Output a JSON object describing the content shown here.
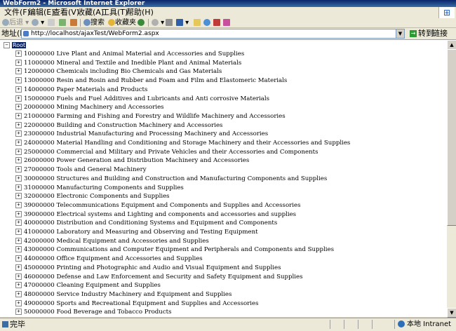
{
  "window": {
    "title": "WebForm2 - Microsoft Internet Explorer"
  },
  "menu": [
    "文件(F)",
    "编辑(E)",
    "查看(V)",
    "收藏(A)",
    "工具(T)",
    "帮助(H)"
  ],
  "toolbar": {
    "back": "后退",
    "search": "搜索",
    "favorites": "收藏夹"
  },
  "address": {
    "label": "地址(D)",
    "url": "http://localhost/ajaxTest/WebForm2.aspx",
    "go": "转到",
    "links": "链接"
  },
  "tree": {
    "root": "Root",
    "nodes": [
      "10000000 Live Plant and Animal Material and Accessories and Supplies",
      "11000000 Mineral and Textile and Inedible Plant and Animal Materials",
      "12000000 Chemicals including Bio Chemicals and Gas Materials",
      "13000000 Resin and Rosin and Rubber and Foam and Film and Elastomeric Materials",
      "14000000 Paper Materials and Products",
      "15000000 Fuels and Fuel Additives and Lubricants and Anti corrosive Materials",
      "20000000 Mining Machinery and Accessories",
      "21000000 Farming and Fishing and Forestry and Wildlife Machinery and Accessories",
      "22000000 Building and Construction Machinery and Accessories",
      "23000000 Industrial Manufacturing and Processing Machinery and Accessories",
      "24000000 Material Handling and Conditioning and Storage Machinery and their Accessories and Supplies",
      "25000000 Commercial and Military and Private Vehicles and their Accessories and Components",
      "26000000 Power Generation and Distribution Machinery and Accessories",
      "27000000 Tools and General Machinery",
      "30000000 Structures and Building and Construction and Manufacturing Components and Supplies",
      "31000000 Manufacturing Components and Supplies",
      "32000000 Electronic Components and Supplies",
      "39000000 Telecommunications Equipment and Components and Supplies and Accessories",
      "39000000 Electrical systems and Lighting and components and accessories and supplies",
      "40000000 Distribution and Conditioning Systems and Equipment and Components",
      "41000000 Laboratory and Measuring and Observing and Testing Equipment",
      "42000000 Medical Equipment and Accessories and Supplies",
      "43000000 Communications and Computer Equipment and Peripherals and Components and Supplies",
      "44000000 Office Equipment and Accessories and Supplies",
      "45000000 Printing and Photographic and Audio and Visual Equipment and Supplies",
      "46000000 Defense and Law Enforcement and Security and Safety Equipment and Supplies",
      "47000000 Cleaning Equipment and Supplies",
      "48000000 Service Industry Machinery and Equipment and Supplies",
      "49000000 Sports and Recreational Equipment and Supplies and Accessories",
      "50000000 Food Beverage and Tobacco Products"
    ]
  },
  "status": {
    "text": "完毕",
    "zone": "本地 Intranet"
  }
}
